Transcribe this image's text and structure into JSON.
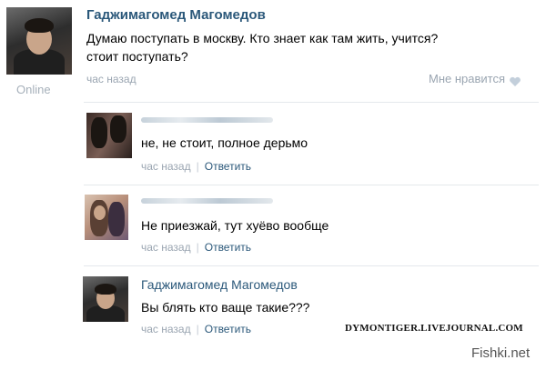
{
  "post": {
    "author": "Гаджимагомед Магомедов",
    "status": "Online",
    "text_line1": "Думаю поступать в москву. Кто знает как там жить, учится?",
    "text_line2": "стоит поступать?",
    "time": "час назад",
    "like_label": "Мне нравится"
  },
  "comments": [
    {
      "text": "не, не стоит, полное дерьмо",
      "time": "час назад",
      "reply": "Ответить"
    },
    {
      "text": "Не приезжай, тут хуёво вообще",
      "time": "час назад",
      "reply": "Ответить"
    },
    {
      "author": "Гаджимагомед Магомедов",
      "text": "Вы блять кто ваще такие???",
      "time": "час назад",
      "reply": "Ответить"
    }
  ],
  "separator": "|",
  "watermarks": {
    "livejournal": "DYMONTIGER.LIVEJOURNAL.COM",
    "fishki": "Fishki.net"
  },
  "colors": {
    "link": "#2b587a",
    "meta": "#9aa5b1",
    "like_heart": "#c3cfdb"
  },
  "icons": [
    "heart-icon"
  ]
}
